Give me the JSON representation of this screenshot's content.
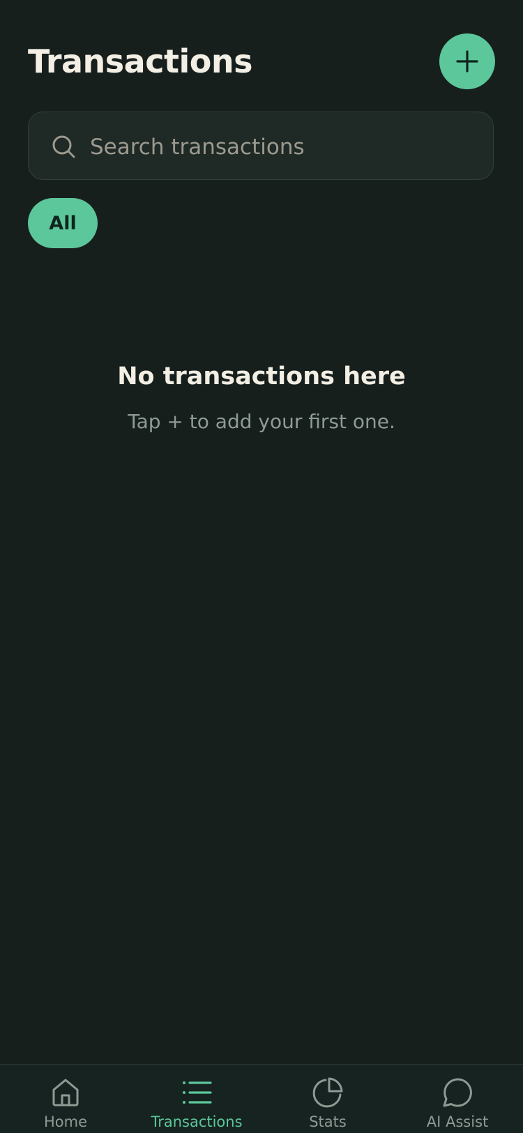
{
  "header": {
    "title": "Transactions",
    "add_button_icon": "plus-icon"
  },
  "search": {
    "placeholder": "Search transactions",
    "value": "",
    "icon": "search-icon"
  },
  "filters": {
    "active_chip": "All"
  },
  "empty_state": {
    "title": "No transactions here",
    "subtitle": "Tap + to add your first one."
  },
  "tabbar": {
    "active": "Transactions",
    "items": [
      {
        "label": "Home",
        "icon": "home-icon"
      },
      {
        "label": "Transactions",
        "icon": "list-icon"
      },
      {
        "label": "Stats",
        "icon": "pie-chart-icon"
      },
      {
        "label": "AI Assist",
        "icon": "chat-bubble-icon"
      }
    ]
  },
  "colors": {
    "background": "#171f1d",
    "accent": "#5cc79b",
    "text_primary": "#f3efe4",
    "text_secondary": "#8e9b94"
  }
}
